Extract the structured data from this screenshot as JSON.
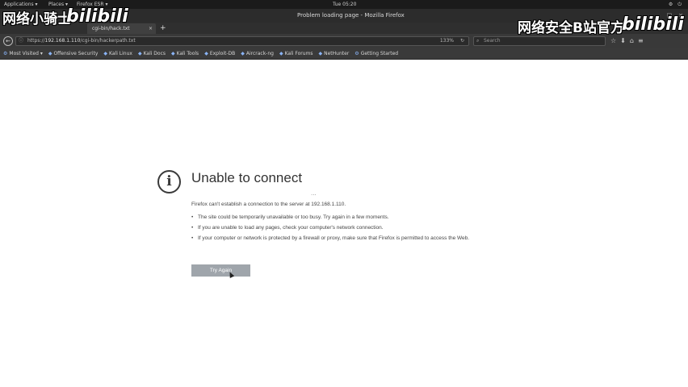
{
  "system_panel": {
    "applications": "Applications ▾",
    "places": "Places ▾",
    "active_app": "Firefox ESR ▾",
    "clock": "Tue 05:20",
    "tray": [
      "⚙",
      "⏻"
    ]
  },
  "window": {
    "title": "Problem loading page - Mozilla Firefox",
    "controls": [
      "–",
      "□",
      "×"
    ]
  },
  "tabs": [
    {
      "label": "cgi-bin/hack.txt",
      "close": "×"
    }
  ],
  "new_tab": "+",
  "navbar": {
    "back": "←",
    "url_prefix": "https://",
    "url_host": "192.168.1.110",
    "url_path": "/cgi-bin/hackerpath.txt",
    "zoom": "133%",
    "reload": "↻",
    "search_placeholder": "Search",
    "icons": [
      "☆",
      "⬇",
      "⌂",
      "≡"
    ]
  },
  "bookmarks": [
    {
      "label": "Most Visited ▾",
      "icon": "⚙"
    },
    {
      "label": "Offensive Security",
      "icon": "◆"
    },
    {
      "label": "Kali Linux",
      "icon": "◆"
    },
    {
      "label": "Kali Docs",
      "icon": "◆"
    },
    {
      "label": "Kali Tools",
      "icon": "◆"
    },
    {
      "label": "Exploit-DB",
      "icon": "◆"
    },
    {
      "label": "Aircrack-ng",
      "icon": "◆"
    },
    {
      "label": "Kali Forums",
      "icon": "◆"
    },
    {
      "label": "NetHunter",
      "icon": "◆"
    },
    {
      "label": "Getting Started",
      "icon": "⚙"
    }
  ],
  "error": {
    "title": "Unable to connect",
    "dots": "...",
    "description": "Firefox can't establish a connection to the server at 192.168.1.110.",
    "bullets": [
      "The site could be temporarily unavailable or too busy. Try again in a few moments.",
      "If you are unable to load any pages, check your computer's network connection.",
      "If your computer or network is protected by a firewall or proxy, make sure that Firefox is permitted to access the Web."
    ],
    "button_label": "Try Again"
  },
  "watermarks": {
    "left_text": "网络小骑士",
    "left_logo": "bilibili",
    "right_text": "网络安全B站官方",
    "right_logo": "bilibili"
  },
  "colors": {
    "button_bg": "#9fa5ab",
    "chrome_dark": "#2c2c2c"
  }
}
